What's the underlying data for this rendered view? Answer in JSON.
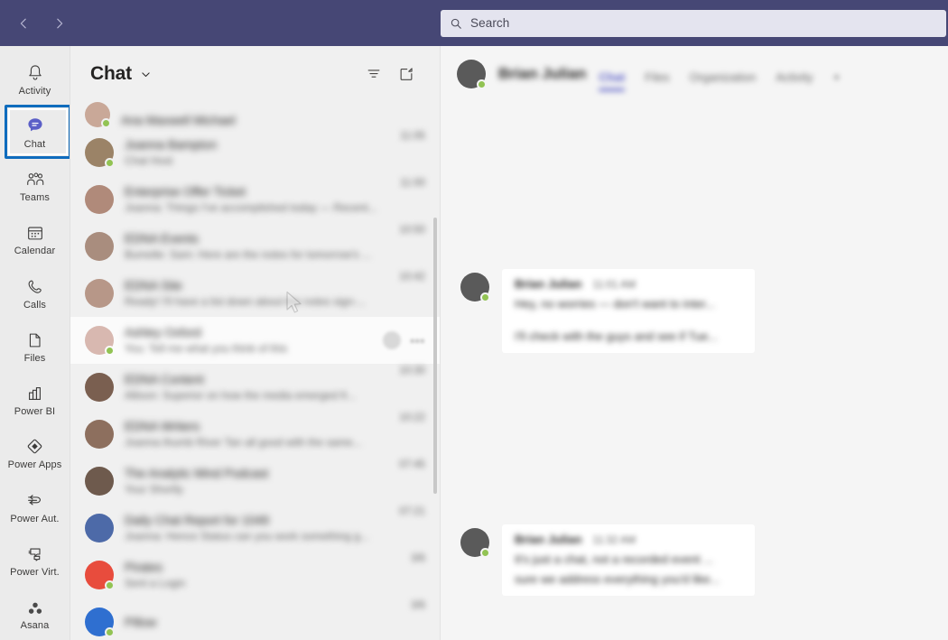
{
  "titlebar": {
    "back_label": "Back",
    "forward_label": "Forward",
    "search_placeholder": "Search"
  },
  "rail": {
    "items": [
      {
        "label": "Activity",
        "icon": "bell-icon",
        "active": false
      },
      {
        "label": "Chat",
        "icon": "chat-bubble-icon",
        "active": true
      },
      {
        "label": "Teams",
        "icon": "people-icon",
        "active": false
      },
      {
        "label": "Calendar",
        "icon": "calendar-icon",
        "active": false
      },
      {
        "label": "Calls",
        "icon": "phone-icon",
        "active": false
      },
      {
        "label": "Files",
        "icon": "file-icon",
        "active": false
      },
      {
        "label": "Power BI",
        "icon": "power-bi-icon",
        "active": false
      },
      {
        "label": "Power Apps",
        "icon": "power-apps-icon",
        "active": false
      },
      {
        "label": "Power Aut.",
        "icon": "power-automate-icon",
        "active": false
      },
      {
        "label": "Power Virt.",
        "icon": "power-virtual-agents-icon",
        "active": false
      },
      {
        "label": "Asana",
        "icon": "asana-icon",
        "active": false
      }
    ]
  },
  "chat_list": {
    "title": "Chat",
    "filter_label": "Filter",
    "compose_label": "New chat",
    "rows": [
      {
        "name": "Ana Maxwell Michael",
        "preview": "",
        "time": "",
        "avatar": "#c9a898",
        "presence": "#92c353",
        "partial": true,
        "hovered": false
      },
      {
        "name": "Joanna Bampton",
        "preview": "Chat Host",
        "time": "11:05",
        "avatar": "#9b8367",
        "presence": "#92c353",
        "partial": false,
        "hovered": false
      },
      {
        "name": "Enterprise Offer Ticket",
        "preview": "Joanna: Things I've accomplished today — Recent...",
        "time": "11:00",
        "avatar": "#b08a7a",
        "presence": "",
        "partial": false,
        "hovered": false
      },
      {
        "name": "EDNA Events",
        "preview": "Bumelle: Sam: Here are the notes for tomorrow's ...",
        "time": "10:50",
        "avatar": "#a98d7e",
        "presence": "",
        "partial": false,
        "hovered": false
      },
      {
        "name": "EDNA Site",
        "preview": "Ready! I'll have a list down about the notes sign-...",
        "time": "10:42",
        "avatar": "#b79788",
        "presence": "",
        "partial": false,
        "hovered": false
      },
      {
        "name": "Ashley Oxford",
        "preview": "You: Tell me what you think of this",
        "time": "",
        "avatar": "#d8b8b0",
        "presence": "#92c353",
        "partial": false,
        "hovered": true
      },
      {
        "name": "EDNA Content",
        "preview": "Allison: Superior on how the media emerged fr...",
        "time": "10:30",
        "avatar": "#7a5f50",
        "presence": "",
        "partial": false,
        "hovered": false
      },
      {
        "name": "EDNA Writers",
        "preview": "Joanna thumb River Tan all good with the same...",
        "time": "10:22",
        "avatar": "#8d6f5e",
        "presence": "",
        "partial": false,
        "hovered": false
      },
      {
        "name": "The Analytic Mind Podcast",
        "preview": "Your Shortly",
        "time": "07:45",
        "avatar": "#6e5a4d",
        "presence": "",
        "partial": false,
        "hovered": false
      },
      {
        "name": "Daily Chat Report for 1049",
        "preview": "Joanna: Hence Status can you work something g...",
        "time": "07:21",
        "avatar": "#4d6aa8",
        "presence": "",
        "partial": false,
        "hovered": false
      },
      {
        "name": "Pirates",
        "preview": "Sent a Login",
        "time": "3/6",
        "avatar": "#e84c3d",
        "presence": "#92c353",
        "partial": false,
        "hovered": false
      },
      {
        "name": "Pillow",
        "preview": "",
        "time": "3/6",
        "avatar": "#2f6fd0",
        "presence": "#92c353",
        "partial": false,
        "hovered": false
      }
    ]
  },
  "conversation": {
    "contact_name": "Brian Julian",
    "presence_color": "#92c353",
    "tabs": [
      {
        "label": "Chat",
        "active": true
      },
      {
        "label": "Files",
        "active": false
      },
      {
        "label": "Organization",
        "active": false
      },
      {
        "label": "Activity",
        "active": false
      }
    ],
    "add_tab_label": "+",
    "messages": [
      {
        "sender": "Brian Julian",
        "time": "11:01 AM",
        "lines": [
          "Hey, no worries — don't want to inter...",
          "I'll check with the guys and see if Tue..."
        ]
      },
      {
        "sender": "Brian Julian",
        "time": "11:32 AM",
        "lines": [
          "It's just a chat, not a recorded event ...",
          "sure we address everything you'd like..."
        ]
      }
    ]
  },
  "theme": {
    "titlebar_purple": "#464775",
    "accent_purple": "#5b5fc7",
    "focus_blue": "#0f6cbd",
    "presence_green": "#92c353",
    "rail_bg": "#ebebeb",
    "list_bg": "#f0f0f0",
    "pane_bg": "#f5f5f5"
  }
}
